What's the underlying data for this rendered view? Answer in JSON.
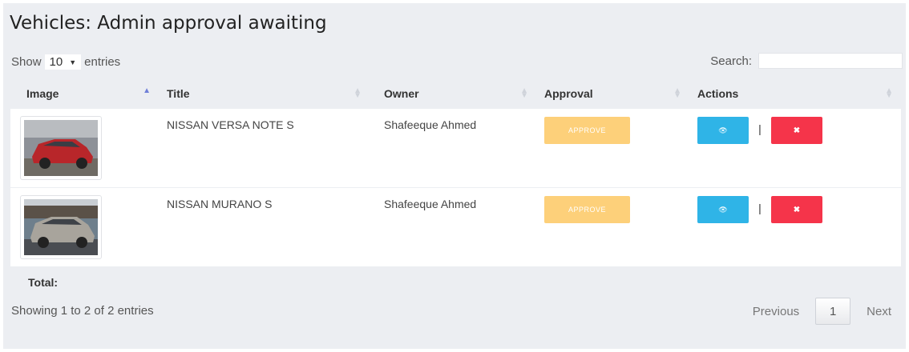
{
  "page": {
    "title": "Vehicles: Admin approval awaiting"
  },
  "length": {
    "prefix": "Show",
    "value": "10",
    "suffix": "entries"
  },
  "search": {
    "label": "Search:",
    "value": ""
  },
  "table": {
    "headers": {
      "image": "Image",
      "title": "Title",
      "owner": "Owner",
      "approval": "Approval",
      "actions": "Actions"
    },
    "rows": [
      {
        "title": "NISSAN VERSA NOTE S",
        "owner": "Shafeeque Ahmed",
        "approve": "APPROVE",
        "view_icon": "eye-icon",
        "delete_icon": "x-icon",
        "separator": "|",
        "car_color": "#b8262a"
      },
      {
        "title": "NISSAN MURANO S",
        "owner": "Shafeeque Ahmed",
        "approve": "APPROVE",
        "view_icon": "eye-icon",
        "delete_icon": "x-icon",
        "separator": "|",
        "car_color": "#a8a49c"
      }
    ],
    "footer": {
      "total_label": "Total:"
    }
  },
  "info": "Showing 1 to 2 of 2 entries",
  "pagination": {
    "previous": "Previous",
    "current": "1",
    "next": "Next"
  },
  "colors": {
    "approve": "#fdd07a",
    "view": "#2fb4e7",
    "delete": "#f5344a",
    "sort_active": "#6f7fd8"
  }
}
